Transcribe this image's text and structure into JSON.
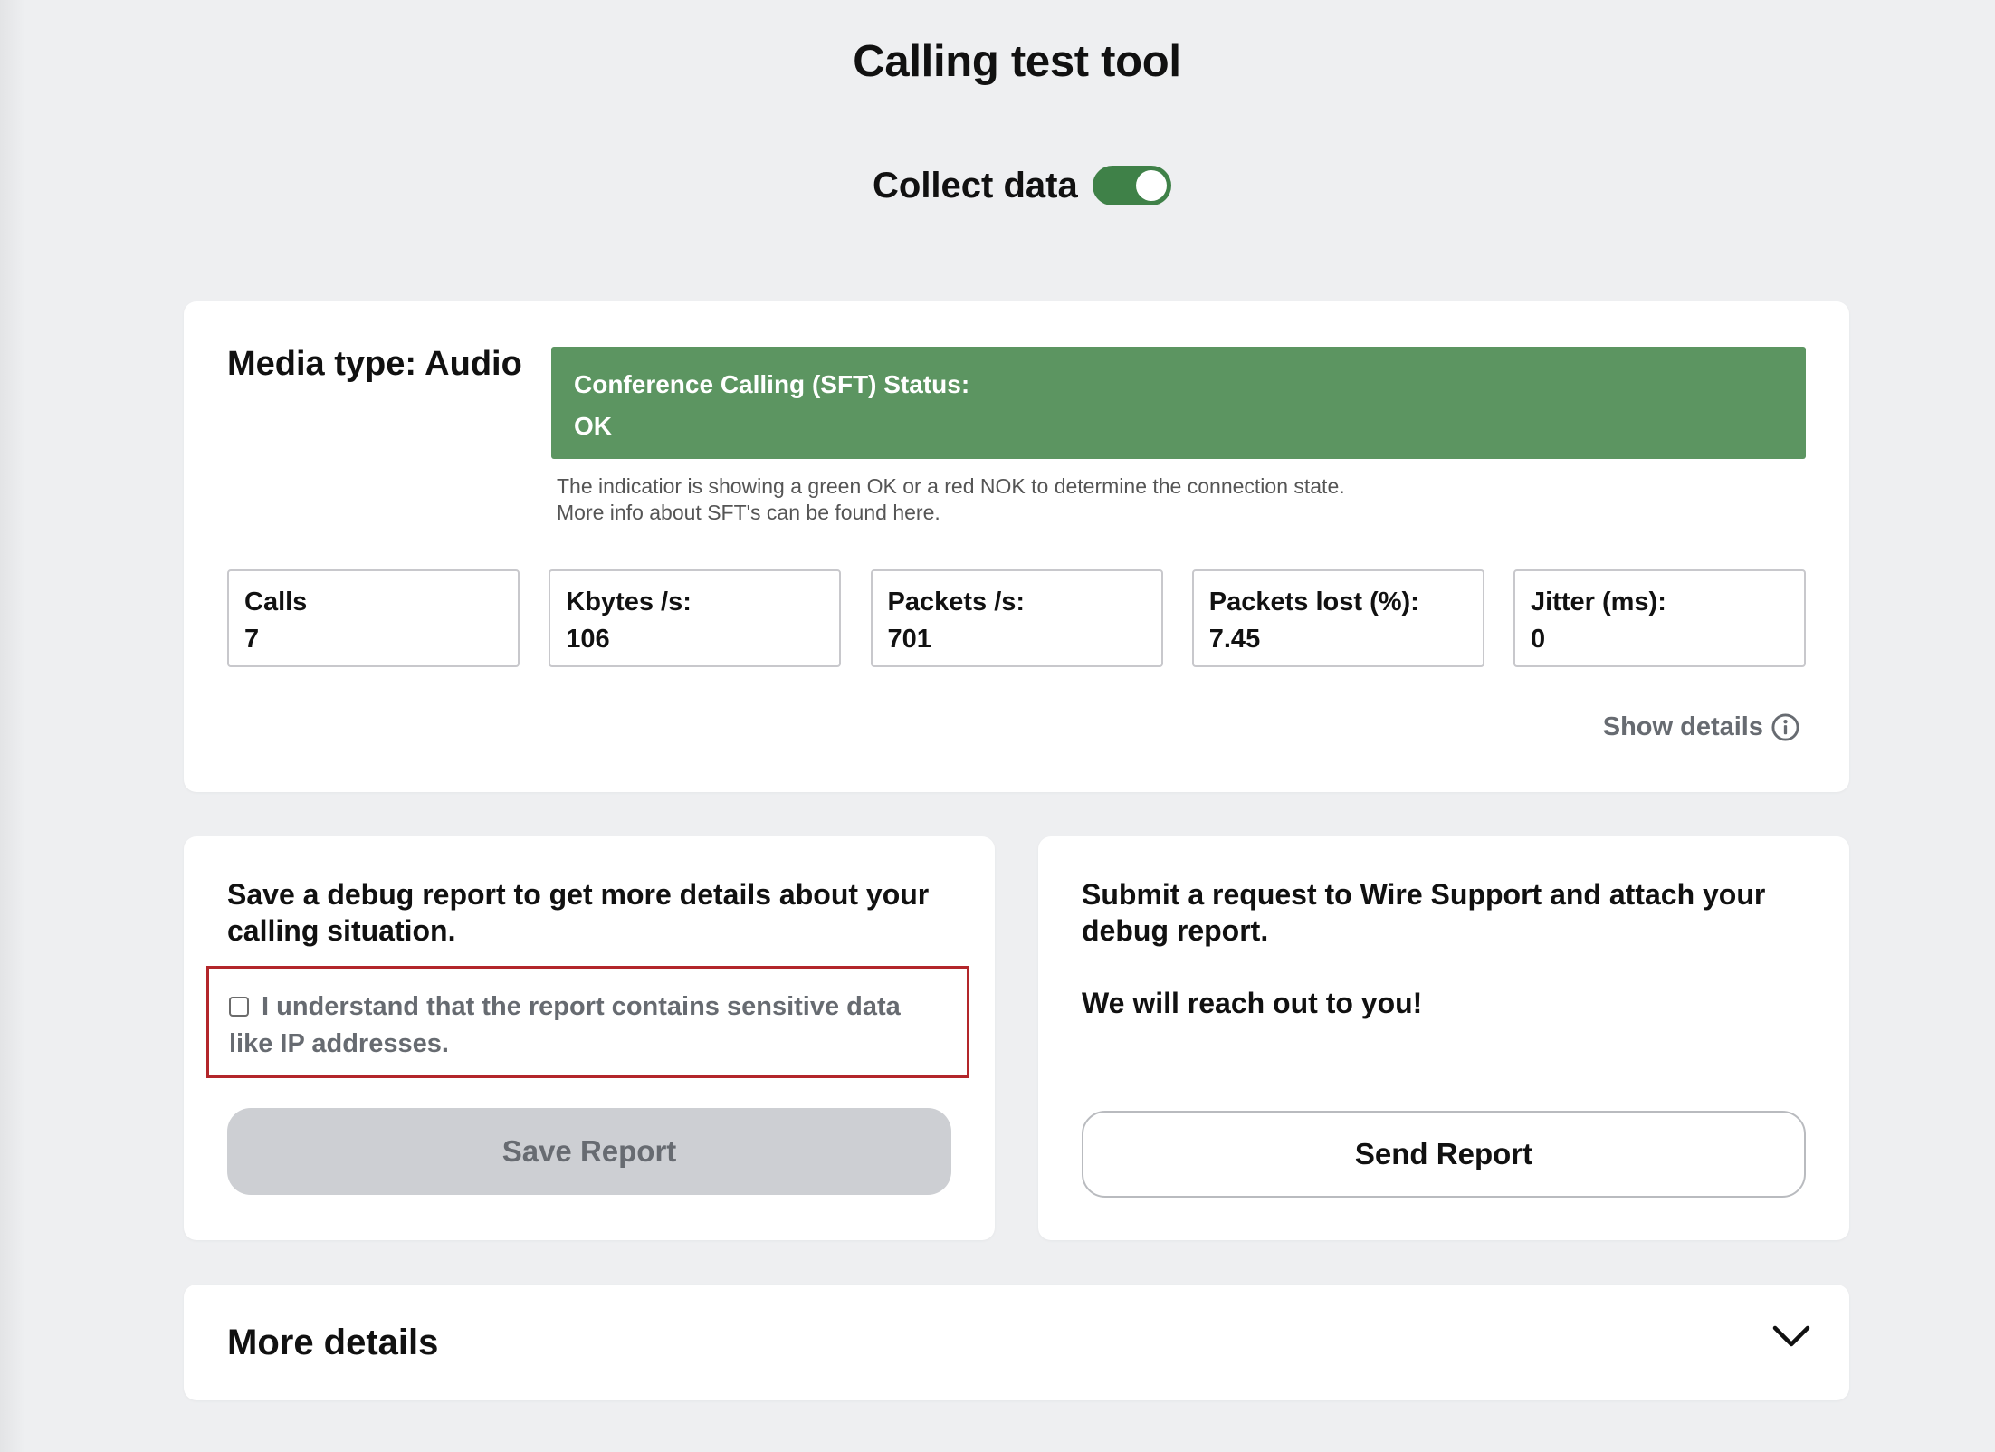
{
  "page": {
    "title": "Calling test tool"
  },
  "collect": {
    "label": "Collect data",
    "enabled": true,
    "toggle_color": "#3f8148"
  },
  "media": {
    "title": "Media type: Audio",
    "status": {
      "heading": "Conference Calling (SFT) Status:",
      "value": "OK",
      "color": "#5c9561"
    },
    "note_line1": "The indicatior is showing a green OK or a red NOK to determine the connection state.",
    "note_line2": "More info about SFT's can be found here.",
    "stats": [
      {
        "label": "Calls",
        "value": "7"
      },
      {
        "label": "Kbytes /s:",
        "value": "106"
      },
      {
        "label": "Packets /s:",
        "value": "701"
      },
      {
        "label": "Packets lost (%):",
        "value": "7.45"
      },
      {
        "label": "Jitter (ms):",
        "value": "0"
      }
    ],
    "show_details": "Show details",
    "show_details_icon": "info-icon"
  },
  "save_card": {
    "text": "Save a debug report to get more details about your calling situation.",
    "consent": "I understand that the report contains sensitive data like IP addresses.",
    "consent_checked": false,
    "consent_border_color": "#b3262a",
    "button": "Save Report"
  },
  "send_card": {
    "text": "Submit a request to Wire Support and attach your debug report.",
    "message": "We will reach out to you!",
    "button": "Send Report"
  },
  "more": {
    "title": "More details",
    "icon": "chevron-down-icon"
  }
}
